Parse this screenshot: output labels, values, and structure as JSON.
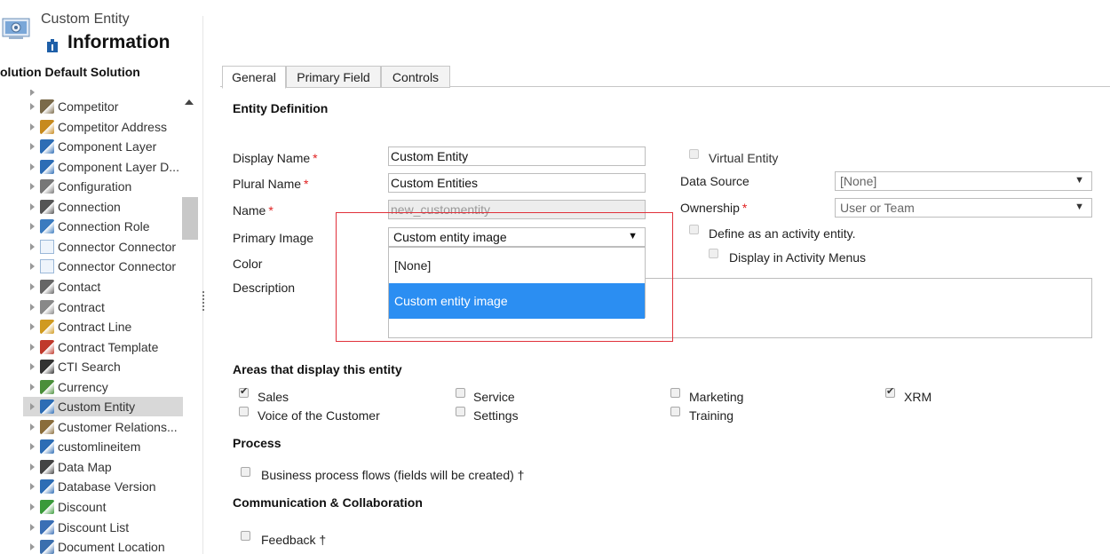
{
  "header": {
    "entity_type": "Custom Entity",
    "title": "Information",
    "solution": "olution Default Solution"
  },
  "tree": {
    "items": [
      {
        "label": "Competitor",
        "icon": "people-icon",
        "selected": false
      },
      {
        "label": "Competitor Address",
        "icon": "address-icon",
        "selected": false
      },
      {
        "label": "Component Layer",
        "icon": "entity-icon",
        "selected": false
      },
      {
        "label": "Component Layer D...",
        "icon": "entity-icon",
        "selected": false
      },
      {
        "label": "Configuration",
        "icon": "tools-icon",
        "selected": false
      },
      {
        "label": "Connection",
        "icon": "connection-icon",
        "selected": false
      },
      {
        "label": "Connection Role",
        "icon": "connection-role-icon",
        "selected": false
      },
      {
        "label": "Connector Connector",
        "icon": "broken-image-icon",
        "selected": false
      },
      {
        "label": "Connector Connector",
        "icon": "broken-image-icon",
        "selected": false
      },
      {
        "label": "Contact",
        "icon": "contact-card-icon",
        "selected": false
      },
      {
        "label": "Contract",
        "icon": "contract-icon",
        "selected": false
      },
      {
        "label": "Contract Line",
        "icon": "contract-line-icon",
        "selected": false
      },
      {
        "label": "Contract Template",
        "icon": "contract-template-icon",
        "selected": false
      },
      {
        "label": "CTI Search",
        "icon": "binoculars-icon",
        "selected": false
      },
      {
        "label": "Currency",
        "icon": "currency-icon",
        "selected": false
      },
      {
        "label": "Custom Entity",
        "icon": "entity-icon",
        "selected": true
      },
      {
        "label": "Customer Relations...",
        "icon": "customer-relations-icon",
        "selected": false
      },
      {
        "label": "customlineitem",
        "icon": "entity-icon",
        "selected": false
      },
      {
        "label": "Data Map",
        "icon": "data-map-icon",
        "selected": false
      },
      {
        "label": "Database Version",
        "icon": "entity-icon",
        "selected": false
      },
      {
        "label": "Discount",
        "icon": "discount-icon",
        "selected": false
      },
      {
        "label": "Discount List",
        "icon": "discount-list-icon",
        "selected": false
      },
      {
        "label": "Document Location",
        "icon": "document-location-icon",
        "selected": false
      }
    ]
  },
  "tabs": [
    {
      "label": "General",
      "active": true
    },
    {
      "label": "Primary Field",
      "active": false
    },
    {
      "label": "Controls",
      "active": false
    }
  ],
  "entity_definition": {
    "heading": "Entity Definition",
    "display_name_label": "Display Name",
    "display_name_value": "Custom Entity",
    "plural_name_label": "Plural Name",
    "plural_name_value": "Custom Entities",
    "name_label": "Name",
    "name_value": "new_customentity",
    "primary_image_label": "Primary Image",
    "primary_image_value": "Custom entity image",
    "color_label": "Color",
    "description_label": "Description",
    "virtual_entity_label": "Virtual Entity",
    "data_source_label": "Data Source",
    "data_source_value": "[None]",
    "ownership_label": "Ownership",
    "ownership_value": "User or Team",
    "activity_entity_label": "Define as an activity entity.",
    "activity_menus_label": "Display in Activity Menus",
    "required_marker": "*"
  },
  "primary_image_dropdown": {
    "options": [
      "[None]",
      "Custom entity image"
    ],
    "highlighted_index": 1
  },
  "areas": {
    "heading": "Areas that display this entity",
    "items": [
      {
        "label": "Sales",
        "checked": true
      },
      {
        "label": "Service",
        "checked": false
      },
      {
        "label": "Marketing",
        "checked": false
      },
      {
        "label": "XRM",
        "checked": true
      },
      {
        "label": "Voice of the Customer",
        "checked": false
      },
      {
        "label": "Settings",
        "checked": false
      },
      {
        "label": "Training",
        "checked": false
      }
    ]
  },
  "process": {
    "heading": "Process",
    "bpf_label": "Business process flows (fields will be created) †"
  },
  "communication": {
    "heading": "Communication & Collaboration",
    "feedback_label": "Feedback †"
  },
  "colors": {
    "highlight": "#2b8ef2",
    "required": "#e02020",
    "annotation_box": "#e0303a",
    "selected_row": "#d8d8d8"
  }
}
